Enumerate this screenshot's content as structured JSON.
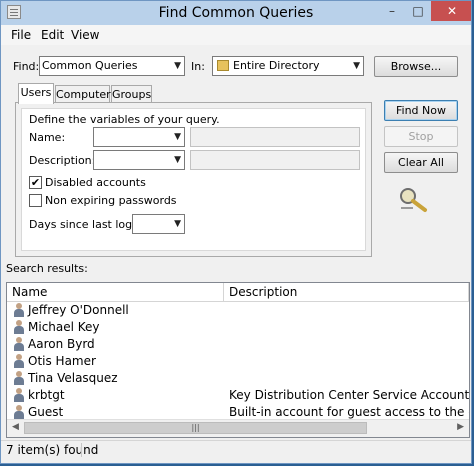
{
  "window": {
    "title": "Find Common Queries"
  },
  "titlebar": {
    "minimize": "–",
    "maximize": "□",
    "close": "✕"
  },
  "menu": [
    "File",
    "Edit",
    "View"
  ],
  "find": {
    "label": "Find:",
    "value": "Common Queries"
  },
  "in": {
    "label": "In:",
    "value": "Entire Directory",
    "icon": "directory-icon"
  },
  "browse_label": "Browse...",
  "tabs": [
    "Users",
    "Computers",
    "Groups"
  ],
  "active_tab": "Users",
  "panel": {
    "intro": "Define the variables of your query.",
    "name_label": "Name:",
    "description_label": "Description:",
    "disabled_accounts": {
      "label": "Disabled accounts",
      "checked": true
    },
    "non_expiring": {
      "label": "Non expiring passwords",
      "checked": false
    },
    "days_label": "Days since last logon:"
  },
  "buttons": {
    "find_now": "Find Now",
    "stop": "Stop",
    "clear_all": "Clear All"
  },
  "search_results_label": "Search results:",
  "results": {
    "columns": [
      "Name",
      "Description"
    ],
    "rows": [
      {
        "name": "Jeffrey O'Donnell",
        "description": ""
      },
      {
        "name": "Michael Key",
        "description": ""
      },
      {
        "name": "Aaron Byrd",
        "description": ""
      },
      {
        "name": "Otis Hamer",
        "description": ""
      },
      {
        "name": "Tina Velasquez",
        "description": ""
      },
      {
        "name": "krbtgt",
        "description": "Key Distribution Center Service Account"
      },
      {
        "name": "Guest",
        "description": "Built-in account for guest access to the computer/"
      }
    ]
  },
  "status": "7 item(s) found"
}
